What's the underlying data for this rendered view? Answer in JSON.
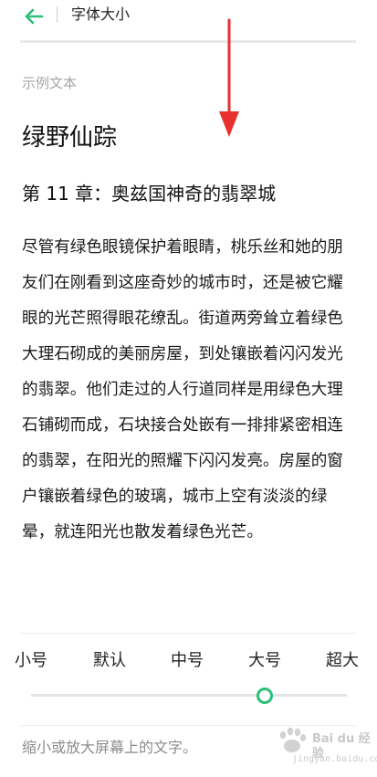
{
  "header": {
    "title": "字体大小",
    "back_icon": "back-arrow-icon",
    "accent_color": "#2bbf77"
  },
  "preview": {
    "label": "示例文本",
    "book_title": "绿野仙踪",
    "chapter_title": "第 11 章：奥兹国神奇的翡翠城",
    "body": "尽管有绿色眼镜保护着眼睛，桃乐丝和她的朋友们在刚看到这座奇妙的城市时，还是被它耀眼的光芒照得眼花缭乱。街道两旁耸立着绿色大理石砌成的美丽房屋，到处镶嵌着闪闪发光的翡翠。他们走过的人行道同样是用绿色大理石铺砌而成，石块接合处嵌有一排排紧密相连的翡翠，在阳光的照耀下闪闪发亮。房屋的窗户镶嵌着绿色的玻璃，城市上空有淡淡的绿晕，就连阳光也散发着绿色光芒。"
  },
  "font_size": {
    "options": [
      "小号",
      "默认",
      "中号",
      "大号",
      "超大"
    ],
    "selected_index": 3,
    "slider_color": "#2bbf77"
  },
  "hint": "缩小或放大屏幕上的文字。",
  "annotation": {
    "arrow_color": "#e8312f"
  },
  "watermark": {
    "brand": "Bai du 经验",
    "url": "jingyan.baidu.com"
  }
}
